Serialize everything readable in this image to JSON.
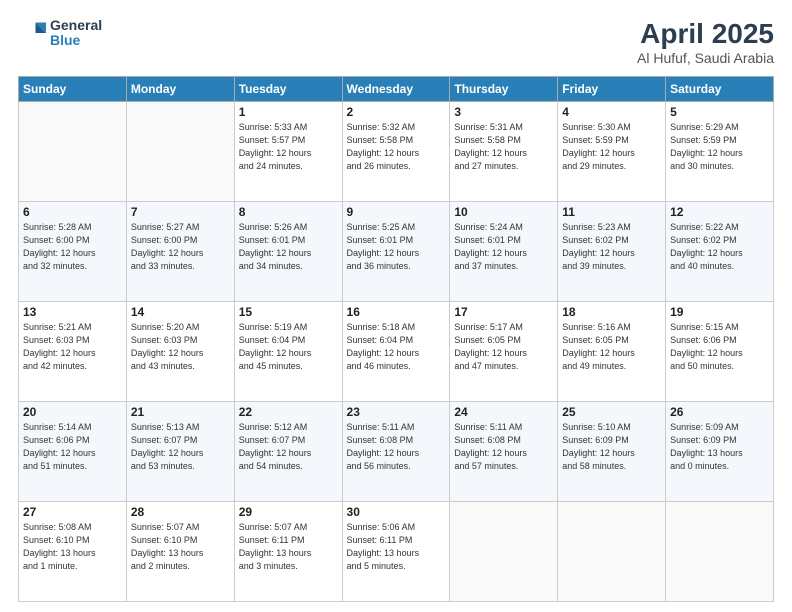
{
  "header": {
    "logo": {
      "general": "General",
      "blue": "Blue"
    },
    "title": "April 2025",
    "location": "Al Hufuf, Saudi Arabia"
  },
  "days_of_week": [
    "Sunday",
    "Monday",
    "Tuesday",
    "Wednesday",
    "Thursday",
    "Friday",
    "Saturday"
  ],
  "weeks": [
    [
      {
        "day": "",
        "info": ""
      },
      {
        "day": "",
        "info": ""
      },
      {
        "day": "1",
        "info": "Sunrise: 5:33 AM\nSunset: 5:57 PM\nDaylight: 12 hours\nand 24 minutes."
      },
      {
        "day": "2",
        "info": "Sunrise: 5:32 AM\nSunset: 5:58 PM\nDaylight: 12 hours\nand 26 minutes."
      },
      {
        "day": "3",
        "info": "Sunrise: 5:31 AM\nSunset: 5:58 PM\nDaylight: 12 hours\nand 27 minutes."
      },
      {
        "day": "4",
        "info": "Sunrise: 5:30 AM\nSunset: 5:59 PM\nDaylight: 12 hours\nand 29 minutes."
      },
      {
        "day": "5",
        "info": "Sunrise: 5:29 AM\nSunset: 5:59 PM\nDaylight: 12 hours\nand 30 minutes."
      }
    ],
    [
      {
        "day": "6",
        "info": "Sunrise: 5:28 AM\nSunset: 6:00 PM\nDaylight: 12 hours\nand 32 minutes."
      },
      {
        "day": "7",
        "info": "Sunrise: 5:27 AM\nSunset: 6:00 PM\nDaylight: 12 hours\nand 33 minutes."
      },
      {
        "day": "8",
        "info": "Sunrise: 5:26 AM\nSunset: 6:01 PM\nDaylight: 12 hours\nand 34 minutes."
      },
      {
        "day": "9",
        "info": "Sunrise: 5:25 AM\nSunset: 6:01 PM\nDaylight: 12 hours\nand 36 minutes."
      },
      {
        "day": "10",
        "info": "Sunrise: 5:24 AM\nSunset: 6:01 PM\nDaylight: 12 hours\nand 37 minutes."
      },
      {
        "day": "11",
        "info": "Sunrise: 5:23 AM\nSunset: 6:02 PM\nDaylight: 12 hours\nand 39 minutes."
      },
      {
        "day": "12",
        "info": "Sunrise: 5:22 AM\nSunset: 6:02 PM\nDaylight: 12 hours\nand 40 minutes."
      }
    ],
    [
      {
        "day": "13",
        "info": "Sunrise: 5:21 AM\nSunset: 6:03 PM\nDaylight: 12 hours\nand 42 minutes."
      },
      {
        "day": "14",
        "info": "Sunrise: 5:20 AM\nSunset: 6:03 PM\nDaylight: 12 hours\nand 43 minutes."
      },
      {
        "day": "15",
        "info": "Sunrise: 5:19 AM\nSunset: 6:04 PM\nDaylight: 12 hours\nand 45 minutes."
      },
      {
        "day": "16",
        "info": "Sunrise: 5:18 AM\nSunset: 6:04 PM\nDaylight: 12 hours\nand 46 minutes."
      },
      {
        "day": "17",
        "info": "Sunrise: 5:17 AM\nSunset: 6:05 PM\nDaylight: 12 hours\nand 47 minutes."
      },
      {
        "day": "18",
        "info": "Sunrise: 5:16 AM\nSunset: 6:05 PM\nDaylight: 12 hours\nand 49 minutes."
      },
      {
        "day": "19",
        "info": "Sunrise: 5:15 AM\nSunset: 6:06 PM\nDaylight: 12 hours\nand 50 minutes."
      }
    ],
    [
      {
        "day": "20",
        "info": "Sunrise: 5:14 AM\nSunset: 6:06 PM\nDaylight: 12 hours\nand 51 minutes."
      },
      {
        "day": "21",
        "info": "Sunrise: 5:13 AM\nSunset: 6:07 PM\nDaylight: 12 hours\nand 53 minutes."
      },
      {
        "day": "22",
        "info": "Sunrise: 5:12 AM\nSunset: 6:07 PM\nDaylight: 12 hours\nand 54 minutes."
      },
      {
        "day": "23",
        "info": "Sunrise: 5:11 AM\nSunset: 6:08 PM\nDaylight: 12 hours\nand 56 minutes."
      },
      {
        "day": "24",
        "info": "Sunrise: 5:11 AM\nSunset: 6:08 PM\nDaylight: 12 hours\nand 57 minutes."
      },
      {
        "day": "25",
        "info": "Sunrise: 5:10 AM\nSunset: 6:09 PM\nDaylight: 12 hours\nand 58 minutes."
      },
      {
        "day": "26",
        "info": "Sunrise: 5:09 AM\nSunset: 6:09 PM\nDaylight: 13 hours\nand 0 minutes."
      }
    ],
    [
      {
        "day": "27",
        "info": "Sunrise: 5:08 AM\nSunset: 6:10 PM\nDaylight: 13 hours\nand 1 minute."
      },
      {
        "day": "28",
        "info": "Sunrise: 5:07 AM\nSunset: 6:10 PM\nDaylight: 13 hours\nand 2 minutes."
      },
      {
        "day": "29",
        "info": "Sunrise: 5:07 AM\nSunset: 6:11 PM\nDaylight: 13 hours\nand 3 minutes."
      },
      {
        "day": "30",
        "info": "Sunrise: 5:06 AM\nSunset: 6:11 PM\nDaylight: 13 hours\nand 5 minutes."
      },
      {
        "day": "",
        "info": ""
      },
      {
        "day": "",
        "info": ""
      },
      {
        "day": "",
        "info": ""
      }
    ]
  ]
}
